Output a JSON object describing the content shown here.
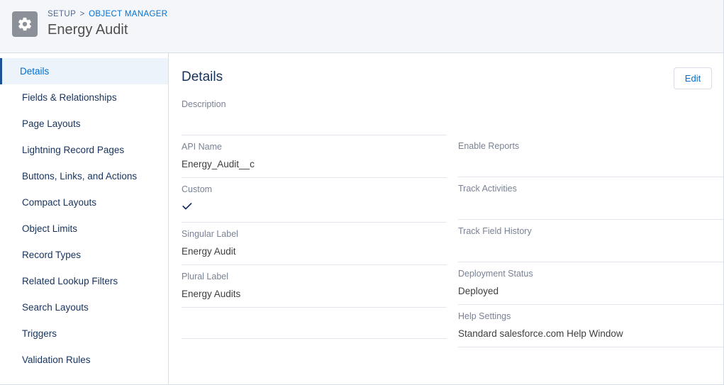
{
  "header": {
    "icon": "gear-icon",
    "breadcrumb": {
      "setup": "SETUP",
      "separator": ">",
      "object_manager": "OBJECT MANAGER"
    },
    "title": "Energy Audit",
    "accent_color": "#0070d2",
    "icon_background": "#8b9099",
    "background": "#f4f6f9"
  },
  "sidebar": {
    "items": [
      {
        "label": "Details",
        "active": true
      },
      {
        "label": "Fields & Relationships",
        "active": false
      },
      {
        "label": "Page Layouts",
        "active": false
      },
      {
        "label": "Lightning Record Pages",
        "active": false
      },
      {
        "label": "Buttons, Links, and Actions",
        "active": false
      },
      {
        "label": "Compact Layouts",
        "active": false
      },
      {
        "label": "Object Limits",
        "active": false
      },
      {
        "label": "Record Types",
        "active": false
      },
      {
        "label": "Related Lookup Filters",
        "active": false
      },
      {
        "label": "Search Layouts",
        "active": false
      },
      {
        "label": "Triggers",
        "active": false
      },
      {
        "label": "Validation Rules",
        "active": false
      }
    ],
    "active_color": "#0070d2",
    "active_background": "#ecf3fb"
  },
  "main": {
    "section_title": "Details",
    "edit_label": "Edit",
    "description": {
      "label": "Description",
      "value": ""
    },
    "left_fields": [
      {
        "label": "API Name",
        "value": "Energy_Audit__c",
        "type": "text"
      },
      {
        "label": "Custom",
        "value": "✔",
        "type": "check"
      },
      {
        "label": "Singular Label",
        "value": "Energy Audit",
        "type": "text"
      },
      {
        "label": "Plural Label",
        "value": "Energy Audits",
        "type": "text"
      },
      {
        "label": "",
        "value": "",
        "type": "blank"
      }
    ],
    "right_fields": [
      {
        "label": "Enable Reports",
        "value": "",
        "type": "text"
      },
      {
        "label": "Track Activities",
        "value": "",
        "type": "text"
      },
      {
        "label": "Track Field History",
        "value": "",
        "type": "text"
      },
      {
        "label": "Deployment Status",
        "value": "Deployed",
        "type": "text"
      },
      {
        "label": "Help Settings",
        "value": "Standard salesforce.com Help Window",
        "type": "text"
      }
    ]
  }
}
